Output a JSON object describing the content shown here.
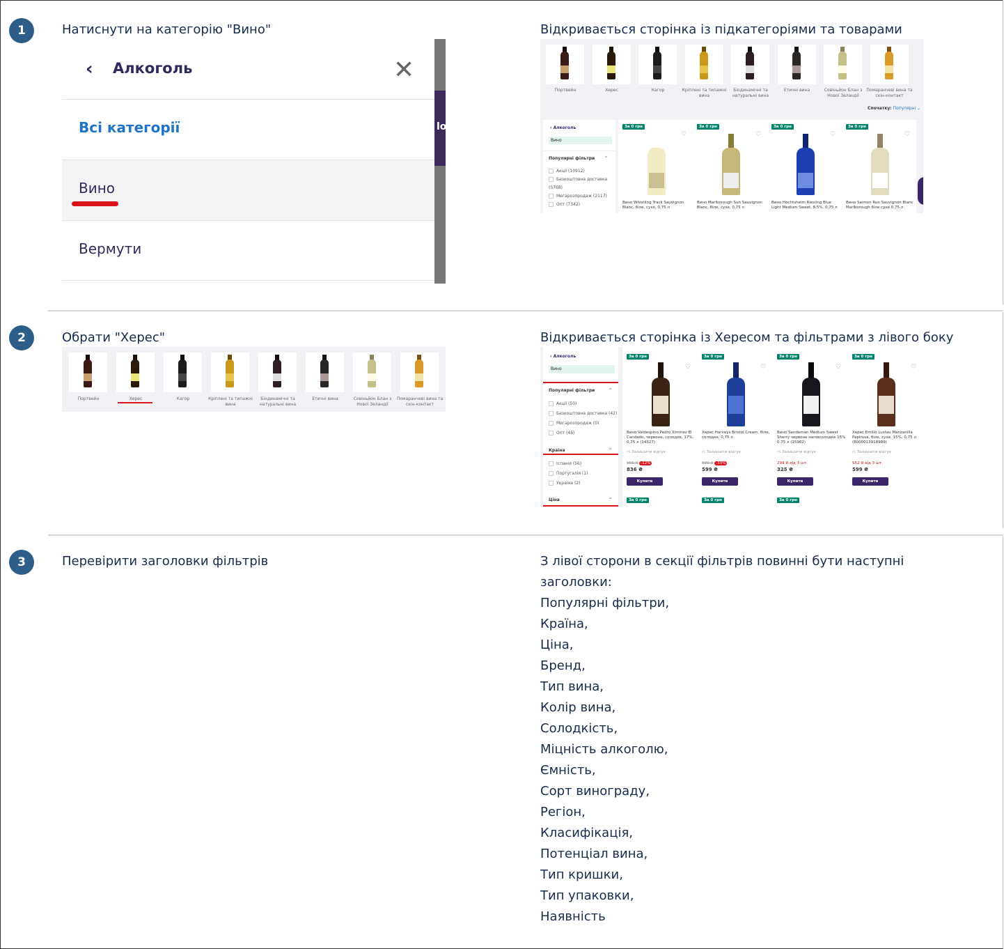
{
  "steps": [
    {
      "num": "1",
      "action": "Натиснути на категорію \"Вино\"",
      "result": "Відкривається сторінка із підкатегоріями та товарами"
    },
    {
      "num": "2",
      "action": "Обрати \"Херес\"",
      "result": "Відкривається сторінка із Хересом та фільтрами з лівого боку"
    },
    {
      "num": "3",
      "action": "Перевірити заголовки фільтрів",
      "result_lines": [
        "З лівої сторони в секції фільтрів повинні бути наступні",
        "заголовки:",
        "Популярні фільтри,",
        "Країна,",
        "Ціна,",
        "Бренд,",
        "Тип вина,",
        "Колір вина,",
        "Солодкість,",
        "Міцність алкоголю,",
        "Ємність,",
        "Сорт винограду,",
        "Регіон,",
        "Класифікація,",
        "Потенціал вина,",
        "Тип кришки,",
        "Тип упаковки,",
        "Наявність"
      ]
    }
  ],
  "menu": {
    "back_icon": "chevron-left-icon",
    "title": "Алкоголь",
    "close_icon": "close-icon",
    "all_categories": "Всі категорії",
    "items": [
      "Вино",
      "Вермути"
    ],
    "edge_letter": "lo",
    "accent": "#1f74c7",
    "highlight": "#d9141b"
  },
  "categories": [
    "Портвейн",
    "Херес",
    "Кагор",
    "Кріплені та тихі вина",
    "Біодинамічні та натуральні вина",
    "Етичні вина",
    "Совіньйон Блан з Нової Зеландії",
    "Помаранчеві вина та скін-контакт"
  ],
  "categories_full_1": {
    "c4": "Кріплені та типажні вина",
    "c5": "Біодинамічні та натуральні вина",
    "c7": "Совіньйон Блан з Нової Зеландії",
    "c8": "Помаранчеві вина та скін-контакт"
  },
  "shot1": {
    "sort_label": "Спочатку:",
    "sort_value": "Популярні",
    "breadcrumb": "Алкоголь",
    "chip": "Вино",
    "filter_title": "Популярні фільтри",
    "filters": [
      "Акції (10912)",
      "Безкоштовна доставка (5768)",
      "Мегарозпродаж (2117)",
      "Опт (7342)"
    ],
    "tag": "За 0 грн",
    "products": [
      "Вино Whistling Track Sauvignon Blanc, біле, сухе, 0,75 л",
      "Вино Marlborough Sun Sauvignon Blanc, біле, сухе, 0,75 л",
      "Вино Hochtsheim Riesling Blue Light Medium Sweet, 8,5%, 0,75 л",
      "Вино Saimon Run Sauvignon Blanc Marlborough біле сухе 0.75 л"
    ]
  },
  "shot2": {
    "breadcrumb": "Алкоголь",
    "chip": "Вино",
    "popular_title": "Популярні фільтри",
    "popular": [
      "Акції (50)",
      "Безкоштовна доставка (42)",
      "Мегарозпродаж (0)",
      "Опт (45)"
    ],
    "country_title": "Країна",
    "countries": [
      "Іспанія (56)",
      "Португалія (1)",
      "Україна (2)"
    ],
    "price_title": "Ціна",
    "tag": "За 0 грн",
    "review": "Залишити відгук",
    "buy": "Купити",
    "products": [
      {
        "title": "Вино Valdespino Pedro Ximinez El Candado, червоне, солодке, 17%, 0,75 л (14327)",
        "old": "955 ₴",
        "disc": "-12%",
        "price": "836 ₴"
      },
      {
        "title": "Херес Harveys Bristol Cream, біле, солодке, 0,75 л",
        "old": "899 ₴",
        "disc": "-33%",
        "price": "599 ₴"
      },
      {
        "title": "Вино Sandeman Medium Sweet Sherry червоне напівсолодке 15% 0.75 л (15982)",
        "old": "299 ₴ від 3 шт.",
        "disc": "",
        "price": "325 ₴"
      },
      {
        "title": "Херес Emilio Lustau Manzanilla Papirusa, біле, сухе, 15%, 0,75 л (8000013918989)",
        "old": "552 ₴ від 3 шт.",
        "disc": "",
        "price": "599 ₴"
      }
    ]
  }
}
